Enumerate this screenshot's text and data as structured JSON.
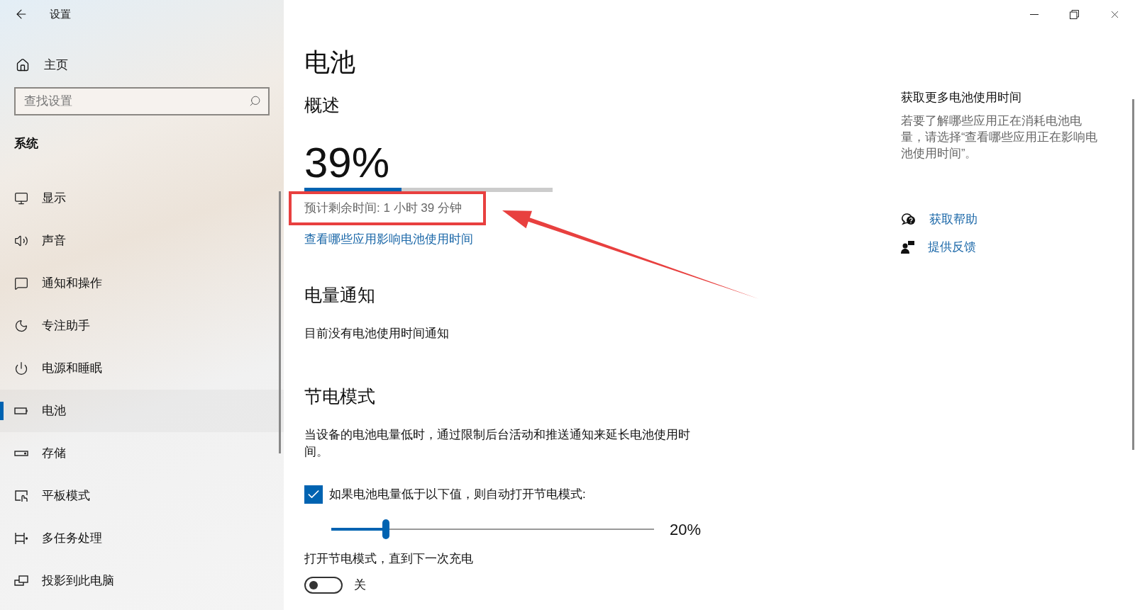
{
  "window": {
    "title": "设置"
  },
  "sidebar": {
    "home": "主页",
    "search": {
      "placeholder": "查找设置"
    },
    "section": "系统",
    "items": [
      {
        "kind": "display",
        "label": "显示",
        "selected": false
      },
      {
        "kind": "sound",
        "label": "声音",
        "selected": false
      },
      {
        "kind": "notifications",
        "label": "通知和操作",
        "selected": false
      },
      {
        "kind": "focus",
        "label": "专注助手",
        "selected": false
      },
      {
        "kind": "power",
        "label": "电源和睡眠",
        "selected": false
      },
      {
        "kind": "battery",
        "label": "电池",
        "selected": true
      },
      {
        "kind": "storage",
        "label": "存储",
        "selected": false
      },
      {
        "kind": "tablet",
        "label": "平板模式",
        "selected": false
      },
      {
        "kind": "multitask",
        "label": "多任务处理",
        "selected": false
      },
      {
        "kind": "project",
        "label": "投影到此电脑",
        "selected": false
      }
    ]
  },
  "page": {
    "title": "电池",
    "overview": {
      "heading": "概述",
      "percent": "39%",
      "level": 0.39,
      "estimate": "预计剩余时间: 1 小时 39 分钟",
      "link": "查看哪些应用影响电池使用时间"
    },
    "notifications": {
      "heading": "电量通知",
      "text": "目前没有电池使用时间通知"
    },
    "saver": {
      "heading": "节电模式",
      "description": "当设备的电池电量低时，通过限制后台活动和推送通知来延长电池使用时间。",
      "auto": {
        "label": "如果电池电量低于以下值，则自动打开节电模式:",
        "checked": true
      },
      "threshold": {
        "level": 0.17,
        "reading": "20%"
      },
      "until_charge": {
        "label": "打开节电模式，直到下一次充电",
        "on": false,
        "state_text": "关"
      }
    }
  },
  "aside": {
    "title": "获取更多电池使用时间",
    "text": "若要了解哪些应用正在消耗电池电量，请选择“查看哪些应用正在影响电池使用时间”。",
    "links": [
      {
        "kind": "help",
        "label": "获取帮助"
      },
      {
        "kind": "feedback",
        "label": "提供反馈"
      }
    ]
  }
}
